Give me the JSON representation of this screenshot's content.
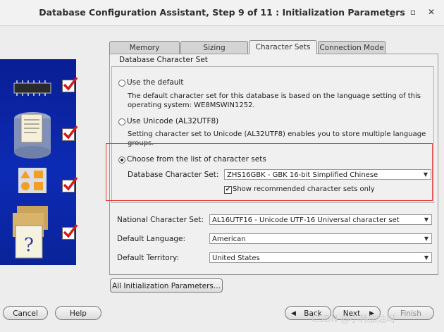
{
  "window": {
    "title": "Database Configuration Assistant, Step 9 of 11 : Initialization Parameters",
    "controls": [
      "_",
      "▫",
      "✕"
    ]
  },
  "tabs": [
    {
      "label": "Memory",
      "active": false
    },
    {
      "label": "Sizing",
      "active": false
    },
    {
      "label": "Character Sets",
      "active": true
    },
    {
      "label": "Connection Mode",
      "active": false
    }
  ],
  "charset_group": {
    "title": "Database Character Set",
    "option_default": {
      "label": "Use the default",
      "desc1": "The default character set for this database is based on the language setting of this",
      "desc2": "operating system: WE8MSWIN1252.",
      "selected": false
    },
    "option_unicode": {
      "label": "Use Unicode (AL32UTF8)",
      "desc1": "Setting character set to Unicode (AL32UTF8) enables you to store multiple language",
      "desc2": "groups.",
      "selected": false
    },
    "option_list": {
      "label": "Choose from the list of character sets",
      "selected": true,
      "db_charset_label": "Database Character Set:",
      "db_charset_value": "ZHS16GBK - GBK 16-bit Simplified Chinese",
      "show_recommended_label": "Show recommended character sets only",
      "show_recommended_checked": true
    }
  },
  "national": {
    "label": "National Character Set:",
    "value": "AL16UTF16 - Unicode UTF-16 Universal character set"
  },
  "language": {
    "label": "Default Language:",
    "value": "American"
  },
  "territory": {
    "label": "Default Territory:",
    "value": "United States"
  },
  "all_params_button": "All Initialization Parameters...",
  "footer": {
    "cancel": "Cancel",
    "help": "Help",
    "back": "Back",
    "next": "Next",
    "finish": "Finish"
  },
  "watermark": "CSDN @小韩加油呀",
  "colors": {
    "highlight_box": "#e33a3a",
    "side_panel": "#0c2bb5"
  }
}
